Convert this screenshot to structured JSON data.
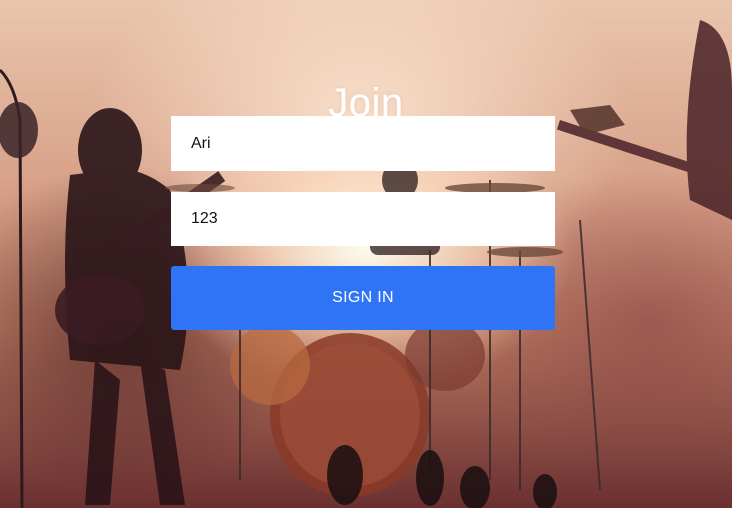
{
  "header": {
    "title": "Join"
  },
  "form": {
    "username_value": "Ari",
    "password_value": "123",
    "submit_label": "SIGN IN"
  },
  "colors": {
    "button": "#2f74f5",
    "title_text": "#ffffff",
    "field_bg": "#ffffff"
  },
  "background": {
    "description_icon": "concert-band-photo"
  }
}
